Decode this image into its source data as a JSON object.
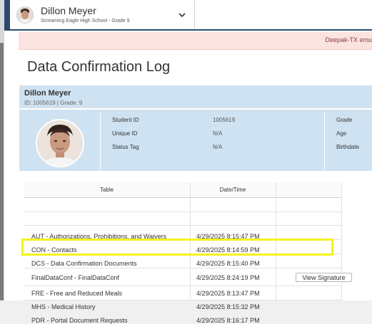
{
  "header": {
    "student_name": "Dillon Meyer",
    "school_line": "Screaming Eagle High School - Grade 9"
  },
  "banner": {
    "text": "Deepak-TX emu"
  },
  "page": {
    "title": "Data Confirmation Log"
  },
  "student": {
    "name": "Dillon Meyer",
    "id_line": "ID: 1005619 |  Grade: 9",
    "fields": {
      "student_id_label": "Student ID",
      "student_id_value": "1005619",
      "unique_id_label": "Unique ID",
      "unique_id_value": "N/A",
      "status_tag_label": "Status Tag",
      "status_tag_value": "N/A",
      "grade_label": "Grade",
      "age_label": "Age",
      "birthdate_label": "Birthdate"
    }
  },
  "table": {
    "columns": [
      "Table",
      "Date/Time"
    ],
    "rows": [
      {
        "table": "AUT - Authorizations, Prohibitions, and Waivers",
        "datetime": "4/29/2025 8:15:47 PM"
      },
      {
        "table": "CON - Contacts",
        "datetime": "4/29/2025 8:14:59 PM"
      },
      {
        "table": "DCS - Data Confirmation Documents",
        "datetime": "4/29/2025 8:15:40 PM"
      },
      {
        "table": "FinalDataConf - FinalDataConf",
        "datetime": "4/29/2025 8:24:19 PM",
        "action": "View Signature"
      },
      {
        "table": "FRE - Free and Reduced Meals",
        "datetime": "4/29/2025 8:13:47 PM"
      },
      {
        "table": "MHS - Medical History",
        "datetime": "4/29/2025 8:15:32 PM"
      },
      {
        "table": "PDR - Portal Document Requests",
        "datetime": "4/29/2025 8:16:17 PM"
      }
    ]
  },
  "colors": {
    "accent": "#2c4a6e",
    "info_bg": "#cfe2f1",
    "banner_bg": "#fbe3e0",
    "highlight": "#f4f21c"
  }
}
